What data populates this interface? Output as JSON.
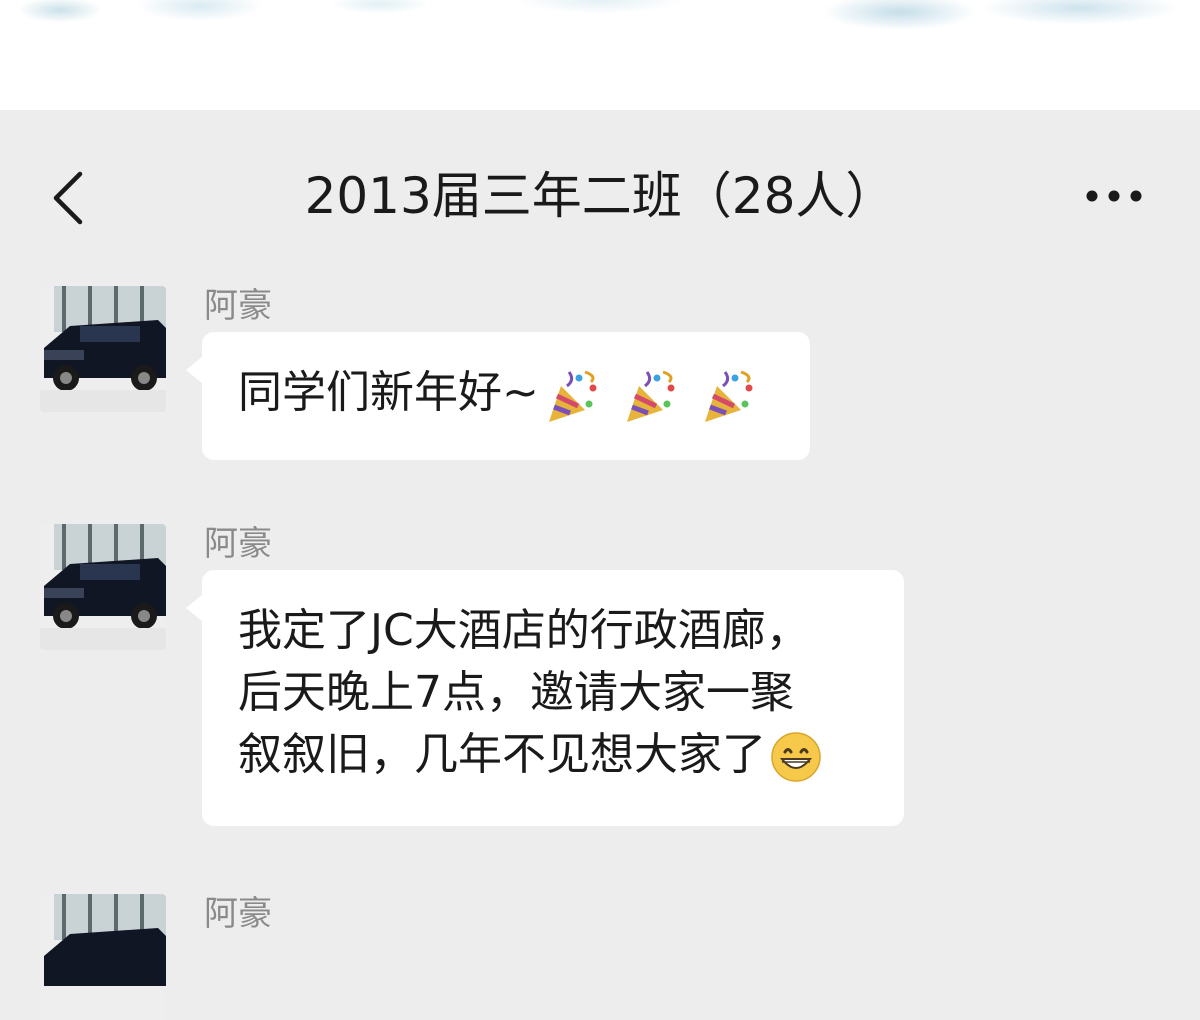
{
  "header": {
    "title": "2013届三年二班（28人）"
  },
  "icons": {
    "back": "chevron-left-icon",
    "more": "more-dots-icon",
    "avatar": "car-photo-avatar",
    "party": "party-popper-emoji",
    "grin": "grinning-face-emoji"
  },
  "messages": [
    {
      "sender": "阿豪",
      "text": "同学们新年好~",
      "emoji_count": 3
    },
    {
      "sender": "阿豪",
      "lines": [
        "我定了JC大酒店的行政酒廊，",
        "后天晚上7点，邀请大家一聚",
        "叙叙旧，几年不见想大家了"
      ]
    },
    {
      "sender": "阿豪"
    }
  ],
  "colors": {
    "background": "#ededed",
    "bubble": "#ffffff",
    "sender_text": "#8a8a8a",
    "main_text": "#1a1a1a"
  }
}
